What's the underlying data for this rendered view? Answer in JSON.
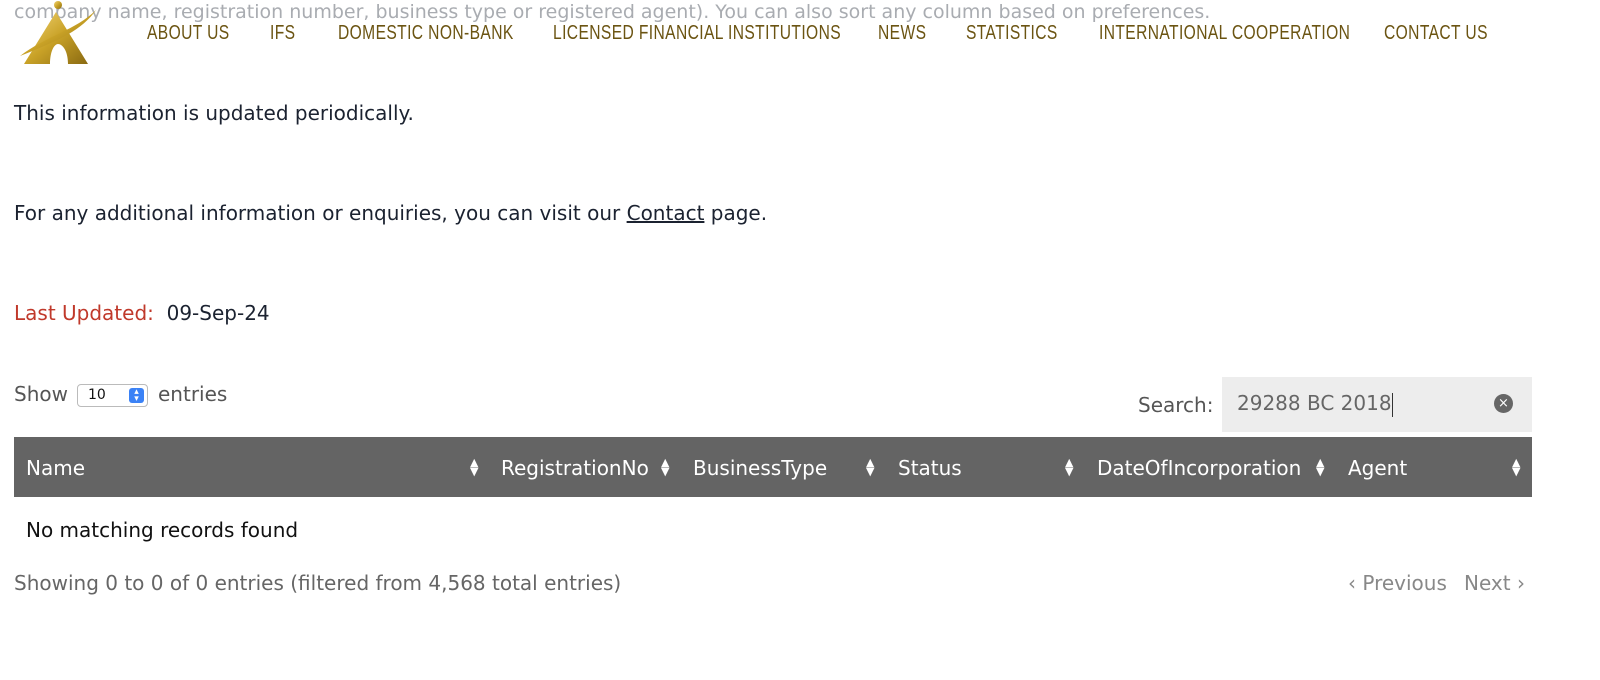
{
  "intro_fragment": "company name, registration number, business type or registered agent). You can also sort any column based on preferences.",
  "nav": [
    "ABOUT US",
    "IFS",
    "DOMESTIC NON-BANK",
    "LICENSED FINANCIAL INSTITUTIONS",
    "NEWS",
    "STATISTICS",
    "INTERNATIONAL COOPERATION",
    "CONTACT US"
  ],
  "colors": {
    "nav": "#6b5412",
    "accent_red": "#c0392b",
    "header_bg": "#646464",
    "logo_gold": "#c9a227"
  },
  "info_text": "This information is updated periodically.",
  "enquiry": {
    "before": "For any additional information or enquiries, you can visit our ",
    "link": "Contact",
    "after": " page."
  },
  "last_updated": {
    "label": "Last Updated:",
    "value": "09-Sep-24"
  },
  "length": {
    "show": "Show",
    "value": "10",
    "entries": "entries"
  },
  "search": {
    "label": "Search:",
    "value": "29288 BC 2018"
  },
  "table": {
    "columns": [
      "Name",
      "RegistrationNo",
      "BusinessType",
      "Status",
      "DateOfIncorporation",
      "Agent"
    ],
    "empty": "No matching records found"
  },
  "info": "Showing 0 to 0 of 0 entries (filtered from 4,568 total entries)",
  "pagination": {
    "previous": "Previous",
    "next": "Next"
  }
}
